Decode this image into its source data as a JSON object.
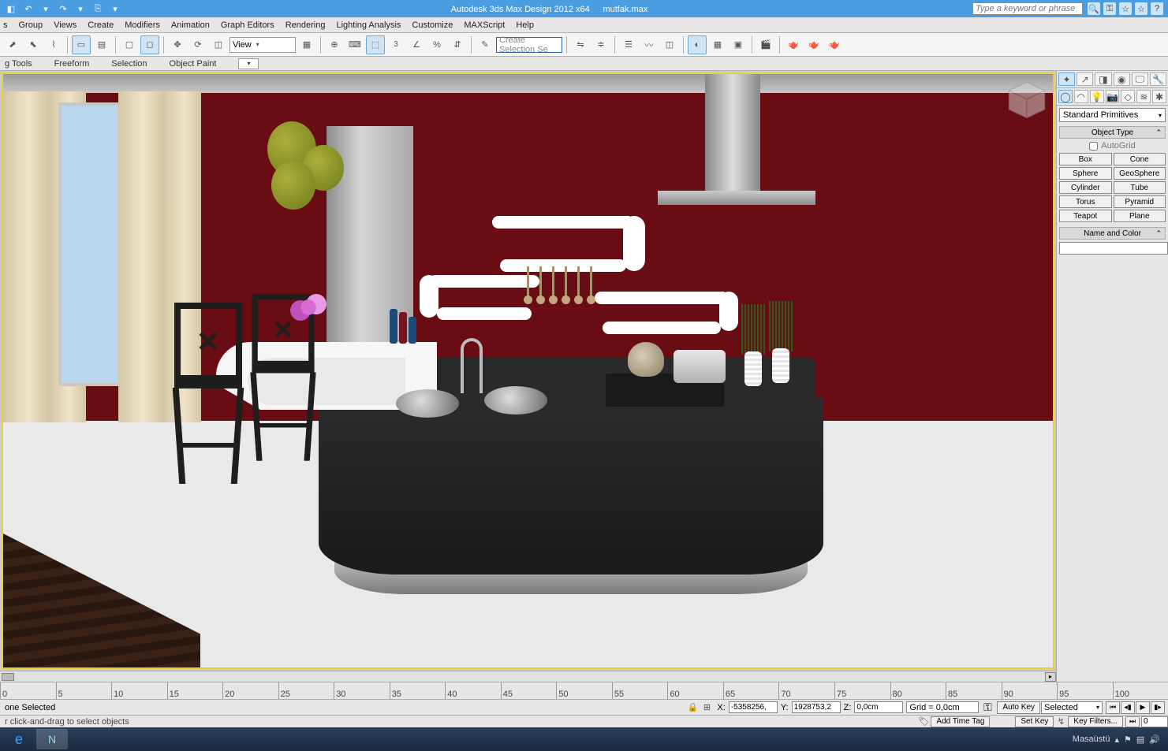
{
  "titlebar": {
    "app_title": "Autodesk 3ds Max Design 2012 x64",
    "filename": "mutfak.max",
    "search_placeholder": "Type a keyword or phrase"
  },
  "menu": {
    "items": [
      "s",
      "Group",
      "Views",
      "Create",
      "Modifiers",
      "Animation",
      "Graph Editors",
      "Rendering",
      "Lighting Analysis",
      "Customize",
      "MAXScript",
      "Help"
    ]
  },
  "toolbar": {
    "view_label": "View",
    "selection_set_placeholder": "Create Selection Se",
    "three_label": "3"
  },
  "ribbon": {
    "tabs": [
      "g Tools",
      "Freeform",
      "Selection",
      "Object Paint"
    ]
  },
  "cmd_panel": {
    "primitive_dropdown": "Standard Primitives",
    "rollout_object_type": "Object Type",
    "autogrid_label": "AutoGrid",
    "buttons": [
      "Box",
      "Cone",
      "Sphere",
      "GeoSphere",
      "Cylinder",
      "Tube",
      "Torus",
      "Pyramid",
      "Teapot",
      "Plane"
    ],
    "rollout_name": "Name and Color",
    "name_value": ""
  },
  "timeline": {
    "ticks": [
      "0",
      "5",
      "10",
      "15",
      "20",
      "25",
      "30",
      "35",
      "40",
      "45",
      "50",
      "55",
      "60",
      "65",
      "70",
      "75",
      "80",
      "85",
      "90",
      "95",
      "100"
    ]
  },
  "status": {
    "selection_text": "one Selected",
    "hint_text": "r click-and-drag to select objects",
    "x_label": "X:",
    "x_value": "-5358256,",
    "y_label": "Y:",
    "y_value": "1928753,2",
    "z_label": "Z:",
    "z_value": "0,0cm",
    "grid_text": "Grid = 0,0cm",
    "autokey_label": "Auto Key",
    "setkey_label": "Set Key",
    "selected_dd": "Selected",
    "keyfilters_label": "Key Filters...",
    "addtimetag_label": "Add Time Tag",
    "frame_value": "0"
  },
  "taskbar": {
    "tray_label": "Masaüstü"
  }
}
